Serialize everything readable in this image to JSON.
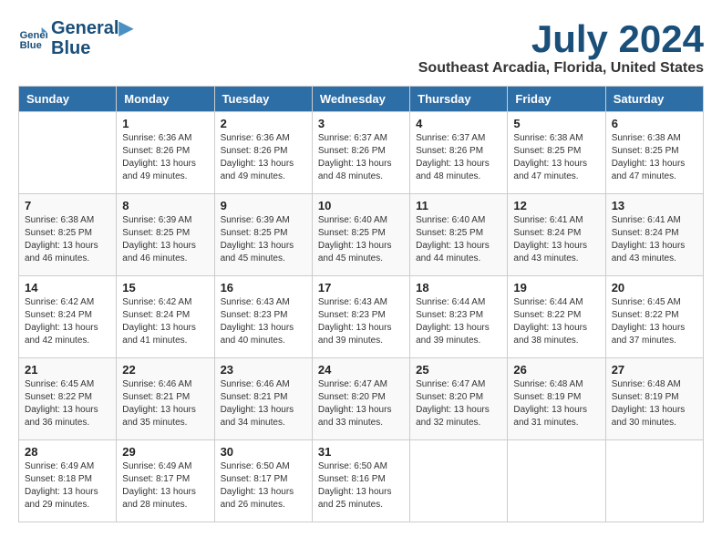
{
  "logo": {
    "line1": "General",
    "line2": "Blue"
  },
  "title": "July 2024",
  "location": "Southeast Arcadia, Florida, United States",
  "days_of_week": [
    "Sunday",
    "Monday",
    "Tuesday",
    "Wednesday",
    "Thursday",
    "Friday",
    "Saturday"
  ],
  "weeks": [
    [
      {
        "day": "",
        "sunrise": "",
        "sunset": "",
        "daylight": ""
      },
      {
        "day": "1",
        "sunrise": "Sunrise: 6:36 AM",
        "sunset": "Sunset: 8:26 PM",
        "daylight": "Daylight: 13 hours and 49 minutes."
      },
      {
        "day": "2",
        "sunrise": "Sunrise: 6:36 AM",
        "sunset": "Sunset: 8:26 PM",
        "daylight": "Daylight: 13 hours and 49 minutes."
      },
      {
        "day": "3",
        "sunrise": "Sunrise: 6:37 AM",
        "sunset": "Sunset: 8:26 PM",
        "daylight": "Daylight: 13 hours and 48 minutes."
      },
      {
        "day": "4",
        "sunrise": "Sunrise: 6:37 AM",
        "sunset": "Sunset: 8:26 PM",
        "daylight": "Daylight: 13 hours and 48 minutes."
      },
      {
        "day": "5",
        "sunrise": "Sunrise: 6:38 AM",
        "sunset": "Sunset: 8:25 PM",
        "daylight": "Daylight: 13 hours and 47 minutes."
      },
      {
        "day": "6",
        "sunrise": "Sunrise: 6:38 AM",
        "sunset": "Sunset: 8:25 PM",
        "daylight": "Daylight: 13 hours and 47 minutes."
      }
    ],
    [
      {
        "day": "7",
        "sunrise": "Sunrise: 6:38 AM",
        "sunset": "Sunset: 8:25 PM",
        "daylight": "Daylight: 13 hours and 46 minutes."
      },
      {
        "day": "8",
        "sunrise": "Sunrise: 6:39 AM",
        "sunset": "Sunset: 8:25 PM",
        "daylight": "Daylight: 13 hours and 46 minutes."
      },
      {
        "day": "9",
        "sunrise": "Sunrise: 6:39 AM",
        "sunset": "Sunset: 8:25 PM",
        "daylight": "Daylight: 13 hours and 45 minutes."
      },
      {
        "day": "10",
        "sunrise": "Sunrise: 6:40 AM",
        "sunset": "Sunset: 8:25 PM",
        "daylight": "Daylight: 13 hours and 45 minutes."
      },
      {
        "day": "11",
        "sunrise": "Sunrise: 6:40 AM",
        "sunset": "Sunset: 8:25 PM",
        "daylight": "Daylight: 13 hours and 44 minutes."
      },
      {
        "day": "12",
        "sunrise": "Sunrise: 6:41 AM",
        "sunset": "Sunset: 8:24 PM",
        "daylight": "Daylight: 13 hours and 43 minutes."
      },
      {
        "day": "13",
        "sunrise": "Sunrise: 6:41 AM",
        "sunset": "Sunset: 8:24 PM",
        "daylight": "Daylight: 13 hours and 43 minutes."
      }
    ],
    [
      {
        "day": "14",
        "sunrise": "Sunrise: 6:42 AM",
        "sunset": "Sunset: 8:24 PM",
        "daylight": "Daylight: 13 hours and 42 minutes."
      },
      {
        "day": "15",
        "sunrise": "Sunrise: 6:42 AM",
        "sunset": "Sunset: 8:24 PM",
        "daylight": "Daylight: 13 hours and 41 minutes."
      },
      {
        "day": "16",
        "sunrise": "Sunrise: 6:43 AM",
        "sunset": "Sunset: 8:23 PM",
        "daylight": "Daylight: 13 hours and 40 minutes."
      },
      {
        "day": "17",
        "sunrise": "Sunrise: 6:43 AM",
        "sunset": "Sunset: 8:23 PM",
        "daylight": "Daylight: 13 hours and 39 minutes."
      },
      {
        "day": "18",
        "sunrise": "Sunrise: 6:44 AM",
        "sunset": "Sunset: 8:23 PM",
        "daylight": "Daylight: 13 hours and 39 minutes."
      },
      {
        "day": "19",
        "sunrise": "Sunrise: 6:44 AM",
        "sunset": "Sunset: 8:22 PM",
        "daylight": "Daylight: 13 hours and 38 minutes."
      },
      {
        "day": "20",
        "sunrise": "Sunrise: 6:45 AM",
        "sunset": "Sunset: 8:22 PM",
        "daylight": "Daylight: 13 hours and 37 minutes."
      }
    ],
    [
      {
        "day": "21",
        "sunrise": "Sunrise: 6:45 AM",
        "sunset": "Sunset: 8:22 PM",
        "daylight": "Daylight: 13 hours and 36 minutes."
      },
      {
        "day": "22",
        "sunrise": "Sunrise: 6:46 AM",
        "sunset": "Sunset: 8:21 PM",
        "daylight": "Daylight: 13 hours and 35 minutes."
      },
      {
        "day": "23",
        "sunrise": "Sunrise: 6:46 AM",
        "sunset": "Sunset: 8:21 PM",
        "daylight": "Daylight: 13 hours and 34 minutes."
      },
      {
        "day": "24",
        "sunrise": "Sunrise: 6:47 AM",
        "sunset": "Sunset: 8:20 PM",
        "daylight": "Daylight: 13 hours and 33 minutes."
      },
      {
        "day": "25",
        "sunrise": "Sunrise: 6:47 AM",
        "sunset": "Sunset: 8:20 PM",
        "daylight": "Daylight: 13 hours and 32 minutes."
      },
      {
        "day": "26",
        "sunrise": "Sunrise: 6:48 AM",
        "sunset": "Sunset: 8:19 PM",
        "daylight": "Daylight: 13 hours and 31 minutes."
      },
      {
        "day": "27",
        "sunrise": "Sunrise: 6:48 AM",
        "sunset": "Sunset: 8:19 PM",
        "daylight": "Daylight: 13 hours and 30 minutes."
      }
    ],
    [
      {
        "day": "28",
        "sunrise": "Sunrise: 6:49 AM",
        "sunset": "Sunset: 8:18 PM",
        "daylight": "Daylight: 13 hours and 29 minutes."
      },
      {
        "day": "29",
        "sunrise": "Sunrise: 6:49 AM",
        "sunset": "Sunset: 8:17 PM",
        "daylight": "Daylight: 13 hours and 28 minutes."
      },
      {
        "day": "30",
        "sunrise": "Sunrise: 6:50 AM",
        "sunset": "Sunset: 8:17 PM",
        "daylight": "Daylight: 13 hours and 26 minutes."
      },
      {
        "day": "31",
        "sunrise": "Sunrise: 6:50 AM",
        "sunset": "Sunset: 8:16 PM",
        "daylight": "Daylight: 13 hours and 25 minutes."
      },
      {
        "day": "",
        "sunrise": "",
        "sunset": "",
        "daylight": ""
      },
      {
        "day": "",
        "sunrise": "",
        "sunset": "",
        "daylight": ""
      },
      {
        "day": "",
        "sunrise": "",
        "sunset": "",
        "daylight": ""
      }
    ]
  ]
}
